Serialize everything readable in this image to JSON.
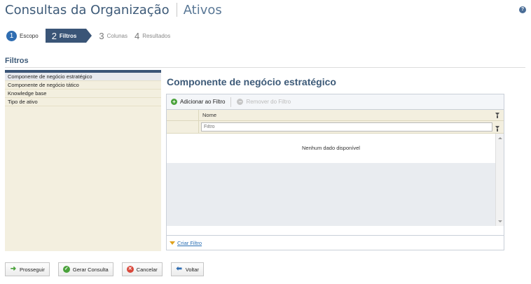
{
  "header": {
    "title": "Consultas da Organização",
    "subtitle": "Ativos"
  },
  "wizard": {
    "steps": [
      {
        "number": "1",
        "label": "Escopo",
        "state": "done"
      },
      {
        "number": "2",
        "label": "Filtros",
        "state": "active"
      },
      {
        "number": "3",
        "label": "Colunas",
        "state": "upcoming"
      },
      {
        "number": "4",
        "label": "Resultados",
        "state": "upcoming"
      }
    ]
  },
  "section": {
    "title": "Filtros"
  },
  "left_panel": {
    "items": [
      {
        "label": "Componente de negócio estratégico",
        "selected": true
      },
      {
        "label": "Componente de negócio tático",
        "selected": false
      },
      {
        "label": "Knowledge base",
        "selected": false
      },
      {
        "label": "Tipo de ativo",
        "selected": false
      }
    ]
  },
  "main": {
    "title": "Componente de negócio estratégico",
    "toolbar": {
      "add_label": "Adicionar ao Filtro",
      "remove_label": "Remover do Filtro"
    },
    "grid": {
      "column_header": "Nome",
      "filter_placeholder": "Filtro",
      "empty_message": "Nenhum dado disponível",
      "footer_link": "Criar Filtro"
    }
  },
  "actions": {
    "proceed": "Prosseguir",
    "generate": "Gerar Consulta",
    "cancel": "Cancelar",
    "back": "Voltar"
  },
  "colors": {
    "title": "#3d5a78",
    "active_step": "#3a5577",
    "panel_bg": "#f3efdf",
    "link": "#2a6fb4",
    "success": "#4aa23b",
    "danger": "#d9473a"
  }
}
